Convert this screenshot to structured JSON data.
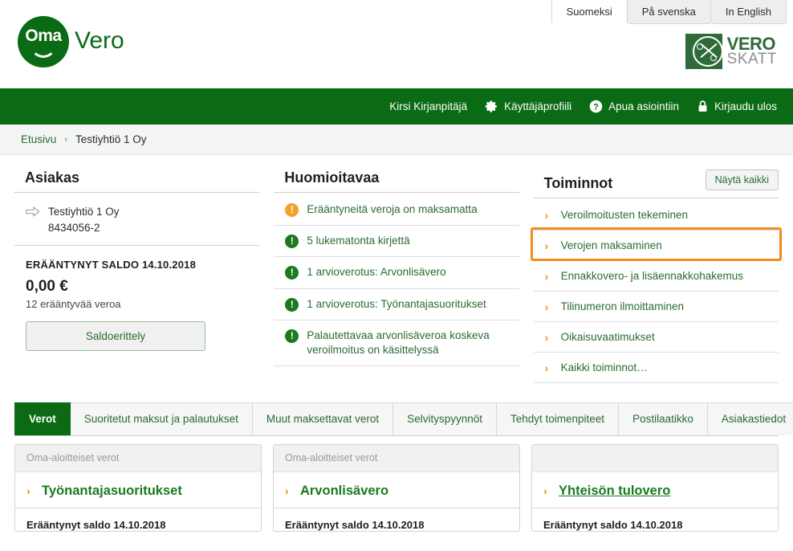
{
  "brand": {
    "logo_primary": "Oma",
    "logo_secondary": "Vero",
    "agency_primary": "VERO",
    "agency_secondary": "SKATT",
    "green": "#0a6b14",
    "orange": "#f08b1d"
  },
  "language_tabs": [
    {
      "label": "Suomeksi",
      "active": true
    },
    {
      "label": "På svenska",
      "active": false
    },
    {
      "label": "In English",
      "active": false
    }
  ],
  "navbar": {
    "user": "Kirsi Kirjanpitäjä",
    "profile": "Käyttäjäprofiili",
    "help": "Apua asiointiin",
    "logout": "Kirjaudu ulos"
  },
  "breadcrumb": {
    "home": "Etusivu",
    "separator": "›",
    "current": "Testiyhtiö 1 Oy"
  },
  "customer_panel": {
    "title": "Asiakas",
    "name": "Testiyhtiö 1 Oy",
    "business_id": "8434056-2",
    "balance_label": "ERÄÄNTYNYT SALDO 14.10.2018",
    "balance_amount": "0,00 €",
    "balance_sub": "12 erääntyvää veroa",
    "balance_button": "Saldoerittely"
  },
  "notices_panel": {
    "title": "Huomioitavaa",
    "items": [
      {
        "text": "Erääntyneitä veroja on maksamatta",
        "color": "#f2a12c"
      },
      {
        "text": "5 lukematonta kirjettä",
        "color": "#1a7a1f"
      },
      {
        "text": "1 arvioverotus: Arvonlisävero",
        "color": "#1a7a1f"
      },
      {
        "text": "1 arvioverotus: Työnantajasuoritukset",
        "color": "#1a7a1f"
      },
      {
        "text": "Palautettavaa arvonlisäveroa koskeva veroilmoitus on käsittelyssä",
        "color": "#1a7a1f"
      }
    ]
  },
  "actions_panel": {
    "title": "Toiminnot",
    "show_all": "Näytä kaikki",
    "items": [
      {
        "label": "Veroilmoitusten tekeminen",
        "highlighted": false
      },
      {
        "label": "Verojen maksaminen",
        "highlighted": true
      },
      {
        "label": "Ennakkovero- ja lisäennakkohakemus",
        "highlighted": false
      },
      {
        "label": "Tilinumeron ilmoittaminen",
        "highlighted": false
      },
      {
        "label": "Oikaisuvaatimukset",
        "highlighted": false
      },
      {
        "label": "Kaikki toiminnot…",
        "highlighted": false
      }
    ]
  },
  "tabs": [
    {
      "label": "Verot",
      "active": true
    },
    {
      "label": "Suoritetut maksut ja palautukset",
      "active": false
    },
    {
      "label": "Muut maksettavat verot",
      "active": false
    },
    {
      "label": "Selvityspyynnöt",
      "active": false
    },
    {
      "label": "Tehdyt toimenpiteet",
      "active": false
    },
    {
      "label": "Postilaatikko",
      "active": false
    },
    {
      "label": "Asiakastiedot",
      "active": false
    }
  ],
  "tax_cards": [
    {
      "category": "Oma-aloitteiset verot",
      "title": "Työnantajasuoritukset",
      "linked": false,
      "balance_label": "Erääntynyt saldo 14.10.2018"
    },
    {
      "category": "Oma-aloitteiset verot",
      "title": "Arvonlisävero",
      "linked": false,
      "balance_label": "Erääntynyt saldo 14.10.2018"
    },
    {
      "category": "",
      "title": "Yhteisön tulovero",
      "linked": true,
      "balance_label": "Erääntynyt saldo 14.10.2018"
    }
  ],
  "icons": {
    "gear": "gear-icon",
    "help": "help-icon",
    "lock": "lock-icon",
    "chevron": "chevron-right-icon",
    "customer_arrow": "arrow-right-icon"
  }
}
